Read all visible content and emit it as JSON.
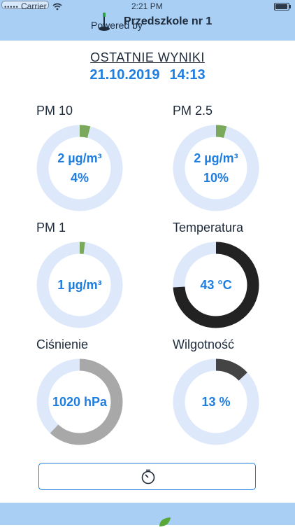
{
  "status_bar": {
    "carrier": "Carrier",
    "time": "2:21 PM"
  },
  "header": {
    "station_name": "Przedszkole nr 1"
  },
  "results": {
    "title": "OSTATNIE WYNIKI",
    "date": "21.10.2019",
    "time": "14:13"
  },
  "tiles": [
    {
      "label": "PM 10",
      "value": "2 µg/m³",
      "percent_text": "4%",
      "fill_fraction": 0.04,
      "fill_color": "#7aa95c"
    },
    {
      "label": "PM 2.5",
      "value": "2 µg/m³",
      "percent_text": "10%",
      "fill_fraction": 0.04,
      "fill_color": "#7aa95c"
    },
    {
      "label": "PM 1",
      "value": "1 µg/m³",
      "percent_text": "",
      "fill_fraction": 0.02,
      "fill_color": "#7aa95c"
    },
    {
      "label": "Temperatura",
      "value": "43 °C",
      "percent_text": "",
      "fill_fraction": 0.74,
      "fill_color": "#222222"
    },
    {
      "label": "Ciśnienie",
      "value": "1020 hPa",
      "percent_text": "",
      "fill_fraction": 0.62,
      "fill_color": "#a8a8a8"
    },
    {
      "label": "Wilgotność",
      "value": "13 %",
      "percent_text": "",
      "fill_fraction": 0.13,
      "fill_color": "#444444"
    }
  ],
  "colors": {
    "accent": "#1e7de0",
    "header_bg": "#a9cff5",
    "ring_track": "#dde9fb"
  },
  "icons": {
    "station": "sensor-station-icon",
    "timer": "timer-icon"
  },
  "footer": {
    "text": "Powered by",
    "leaf": "leaf-logo-icon"
  }
}
